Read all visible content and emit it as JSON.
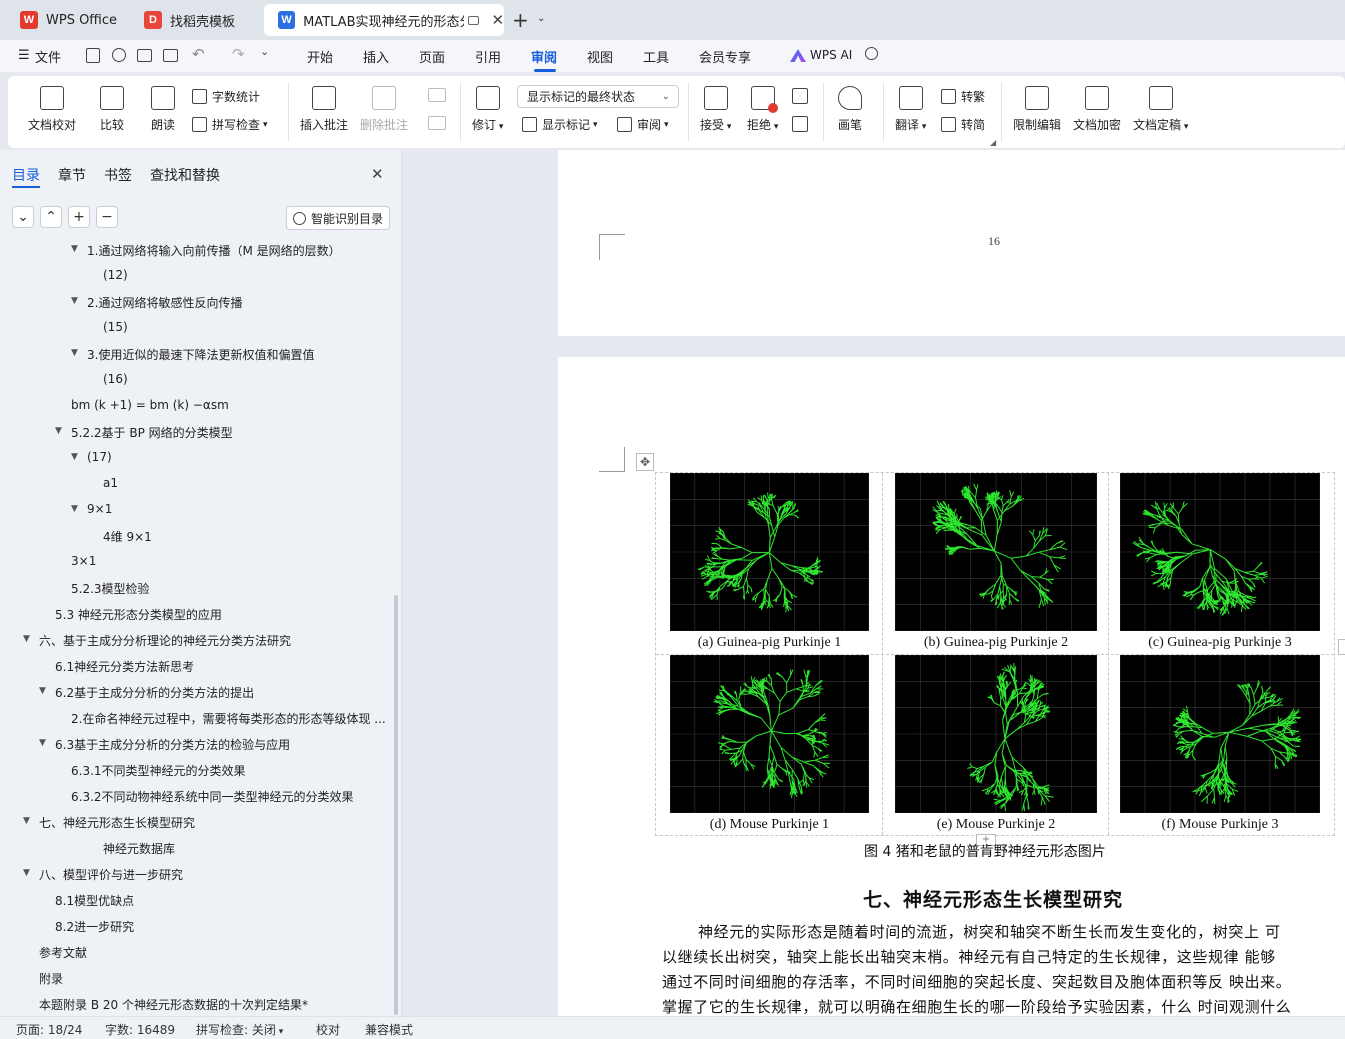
{
  "tabs": [
    {
      "label": "WPS Office",
      "icon": "wps-logo-icon"
    },
    {
      "label": "找稻壳模板",
      "icon": "docer-logo-icon"
    },
    {
      "label": "MATLAB实现神经元的形态分",
      "icon": "word-doc-icon"
    }
  ],
  "menu": {
    "file": "文件",
    "items": [
      "开始",
      "插入",
      "页面",
      "引用",
      "审阅",
      "视图",
      "工具",
      "会员专享"
    ],
    "active": "审阅",
    "wps_ai": "WPS AI"
  },
  "ribbon": {
    "doc_check": "文档校对",
    "compare": "比较",
    "read_aloud": "朗读",
    "word_count": "字数统计",
    "spell_check": "拼写检查",
    "insert_comment": "插入批注",
    "delete_comment": "删除批注",
    "track_changes": "修订",
    "display_mode": "显示标记的最终状态",
    "show_markup": "显示标记",
    "review_pane": "审阅",
    "accept": "接受",
    "reject": "拒绝",
    "pen": "画笔",
    "translate": "翻译",
    "to_traditional": "转繁",
    "to_simplified": "转简",
    "restrict_edit": "限制编辑",
    "encrypt": "文档加密",
    "finalize": "文档定稿"
  },
  "panel": {
    "tabs": [
      "目录",
      "章节",
      "书签",
      "查找和替换"
    ],
    "smart_toc": "智能识别目录",
    "toc": [
      {
        "text": "1.通过网络将输入向前传播（M 是网络的层数）",
        "tri": true
      },
      {
        "text": "(12)",
        "tri": false
      },
      {
        "text": "2.通过网络将敏感性反向传播",
        "tri": true
      },
      {
        "text": "(15)",
        "tri": false
      },
      {
        "text": "3.使用近似的最速下降法更新权值和偏置值",
        "tri": true
      },
      {
        "text": "(16)",
        "tri": false
      },
      {
        "text": "bm (k +1) = bm (k) −αsm",
        "tri": false
      },
      {
        "text": "5.2.2基于 BP 网络的分类模型",
        "tri": true
      },
      {
        "text": "(17)",
        "tri": true
      },
      {
        "text": "a1",
        "tri": false
      },
      {
        "text": "9×1",
        "tri": true
      },
      {
        "text": "4维 9×1",
        "tri": false
      },
      {
        "text": "3×1",
        "tri": false
      },
      {
        "text": "5.2.3模型检验",
        "tri": false
      },
      {
        "text": "5.3 神经元形态分类模型的应用",
        "tri": false
      },
      {
        "text": "六、基于主成分分析理论的神经元分类方法研究",
        "tri": true
      },
      {
        "text": "6.1神经元分类方法新思考",
        "tri": false
      },
      {
        "text": "6.2基于主成分分析的分类方法的提出",
        "tri": true
      },
      {
        "text": "2.在命名神经元过程中，需要将每类形态的形态等级体现 ...",
        "tri": false
      },
      {
        "text": "6.3基于主成分分析的分类方法的检验与应用",
        "tri": true
      },
      {
        "text": "6.3.1不同类型神经元的分类效果",
        "tri": false
      },
      {
        "text": "6.3.2不同动物神经系统中同一类型神经元的分类效果",
        "tri": false
      },
      {
        "text": "七、神经元形态生长模型研究",
        "tri": true
      },
      {
        "text": "神经元数据库",
        "tri": false
      },
      {
        "text": "八、模型评价与进一步研究",
        "tri": true
      },
      {
        "text": "8.1模型优缺点",
        "tri": false
      },
      {
        "text": "8.2进一步研究",
        "tri": false
      },
      {
        "text": "参考文献",
        "tri": false
      },
      {
        "text": "附录",
        "tri": false
      },
      {
        "text": "本题附录 B 20 个神经元形态数据的十次判定结果*",
        "tri": false
      }
    ]
  },
  "doc": {
    "page_number": "16",
    "figure_captions": [
      "(a) Guinea-pig Purkinje 1",
      "(b) Guinea-pig Purkinje 2",
      "(c) Guinea-pig Purkinje 3",
      "(d) Mouse Purkinje 1",
      "(e) Mouse Purkinje 2",
      "(f) Mouse Purkinje 3"
    ],
    "figure_title": "图 4 猪和老鼠的普肯野神经元形态图片",
    "section_heading": "七、神经元形态生长模型研究",
    "paragraph_lines": [
      "神经元的实际形态是随着时间的流逝，树突和轴突不断生长而发生变化的，树突上  可",
      "以继续长出树突，轴突上能长出轴突末梢。神经元有自己特定的生长规律，这些规律  能够",
      "通过不同时间细胞的存活率，不同时间细胞的突起长度、突起数目及胞体面积等反  映出来。",
      "掌握了它的生长规律，就可以明确在细胞生长的哪一阶段给予实验因素，什么  时间观测什么"
    ]
  },
  "status": {
    "page": "页面: 18/24",
    "words": "字数: 16489",
    "spell": "拼写检查: 关闭",
    "proof": "校对",
    "compat": "兼容模式"
  }
}
